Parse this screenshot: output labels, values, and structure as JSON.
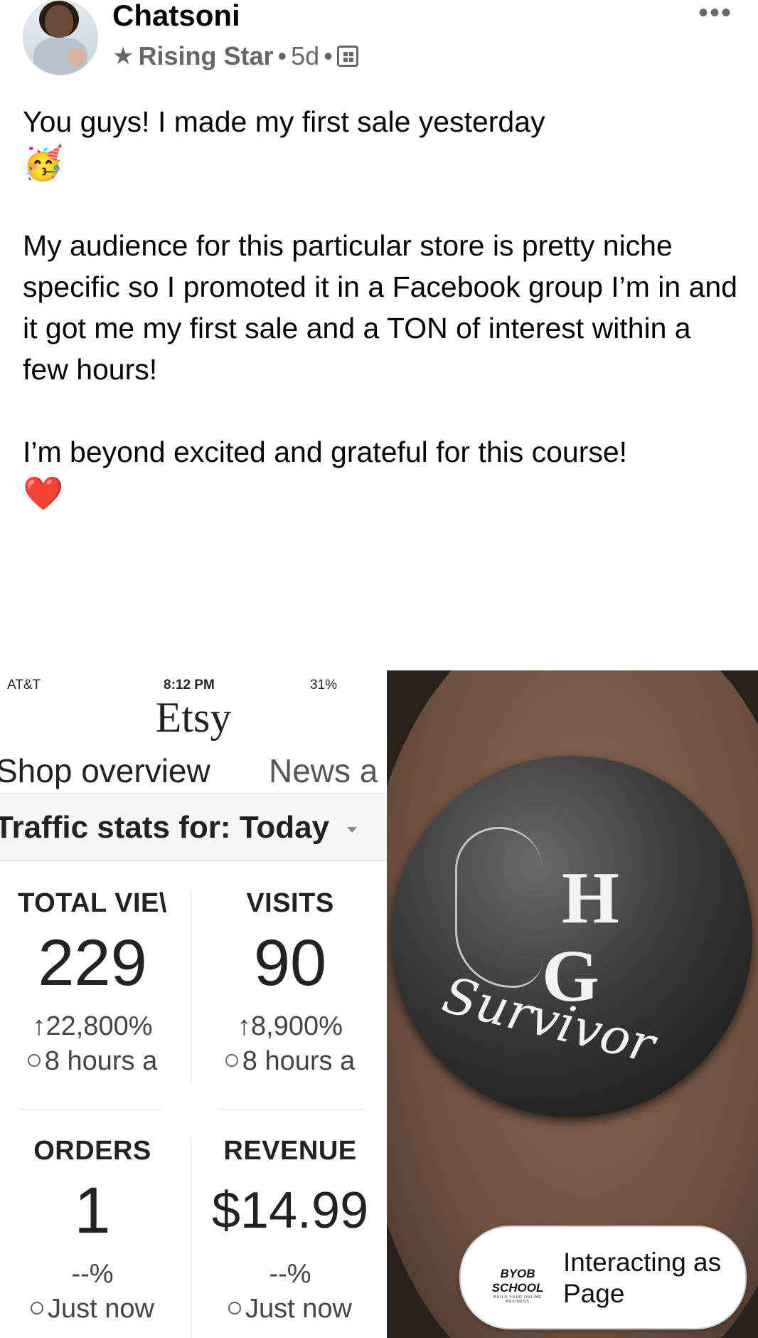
{
  "post": {
    "author": "Chatsoni",
    "badge": "Rising Star",
    "separator": "•",
    "age": "5d",
    "more_label": "•••",
    "line1": "You guys! I made my first sale yesterday",
    "emoji1": "🥳",
    "para2": "My audience for this particular store is pretty niche specific so I promoted it in a Facebook group I’m in and it got me my first sale and a TON of interest within a few hours!",
    "line3": "I’m beyond excited and grateful for this course!",
    "emoji2": "❤️"
  },
  "etsy_screenshot": {
    "carrier": "AT&T",
    "time": "8:12 PM",
    "battery": "31%",
    "logo": "Etsy",
    "tab_active": "Shop overview",
    "tab_other": "News a",
    "traffic_label": "Traffic stats for: Today",
    "stats": [
      {
        "label": "TOTAL VIE\\",
        "value": "229",
        "change": "22,800%",
        "when": "8 hours a"
      },
      {
        "label": "VISITS",
        "value": "90",
        "change": "8,900%",
        "when": "8 hours a"
      },
      {
        "label": "ORDERS",
        "value": "1",
        "change": "--%",
        "when": "Just now"
      },
      {
        "label": "REVENUE",
        "value": "$14.99",
        "change": "--%",
        "when": "Just now"
      }
    ]
  },
  "product_photo": {
    "letter1": "H",
    "letter2": "G",
    "script": "Survivor"
  },
  "interacting_chip": {
    "logo": "BYOB SCHOOL",
    "logo_sub": "BUILD YOUR ONLINE BUSINESS",
    "text": "Interacting as Page"
  }
}
